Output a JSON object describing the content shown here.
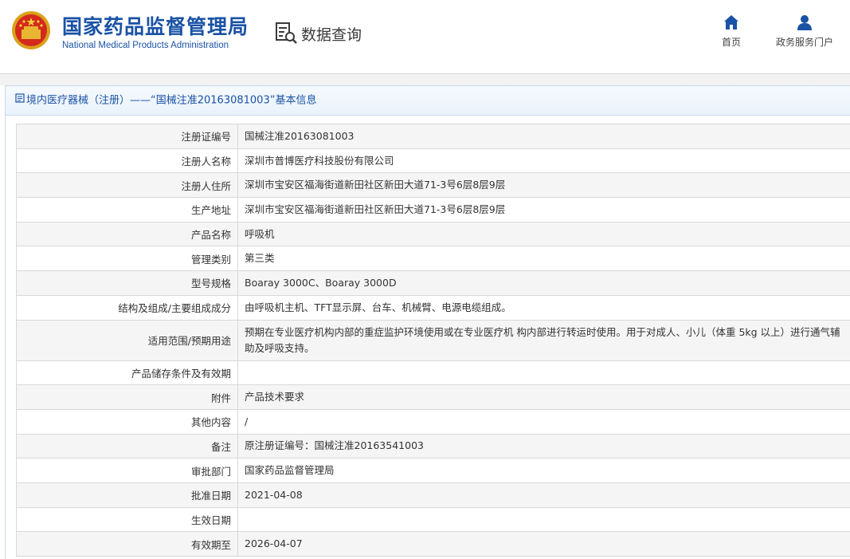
{
  "header": {
    "org_name_cn": "国家药品监督管理局",
    "org_name_en": "National Medical Products Administration",
    "section_title": "数据查询",
    "nav": [
      {
        "label": "首页",
        "icon": "home-icon"
      },
      {
        "label": "政务服务门户",
        "icon": "user-icon"
      }
    ],
    "brand_color": "#1a52a5"
  },
  "panel": {
    "title": "境内医疗器械（注册）——“国械注准20163081003”基本信息"
  },
  "rows": [
    {
      "label": "注册证编号",
      "value": "国械注准20163081003"
    },
    {
      "label": "注册人名称",
      "value": "深圳市普博医疗科技股份有限公司"
    },
    {
      "label": "注册人住所",
      "value": "深圳市宝安区福海街道新田社区新田大道71-3号6层8层9层"
    },
    {
      "label": "生产地址",
      "value": "深圳市宝安区福海街道新田社区新田大道71-3号6层8层9层"
    },
    {
      "label": "产品名称",
      "value": "呼吸机"
    },
    {
      "label": "管理类别",
      "value": "第三类"
    },
    {
      "label": "型号规格",
      "value": "Boaray 3000C、Boaray 3000D"
    },
    {
      "label": "结构及组成/主要组成成分",
      "value": "由呼吸机主机、TFT显示屏、台车、机械臂、电源电缆组成。"
    },
    {
      "label": "适用范围/预期用途",
      "value": "预期在专业医疗机构内部的重症监护环境使用或在专业医疗机 构内部进行转运时使用。用于对成人、小儿（体重 5kg 以上）进行通气辅助及呼吸支持。"
    },
    {
      "label": "产品储存条件及有效期",
      "value": ""
    },
    {
      "label": "附件",
      "value": "产品技术要求"
    },
    {
      "label": "其他内容",
      "value": "/"
    },
    {
      "label": "备注",
      "value": "原注册证编号：国械注准20163541003"
    },
    {
      "label": "审批部门",
      "value": "国家药品监督管理局"
    },
    {
      "label": "批准日期",
      "value": "2021-04-08"
    },
    {
      "label": "生效日期",
      "value": ""
    },
    {
      "label": "有效期至",
      "value": "2026-04-07"
    }
  ]
}
